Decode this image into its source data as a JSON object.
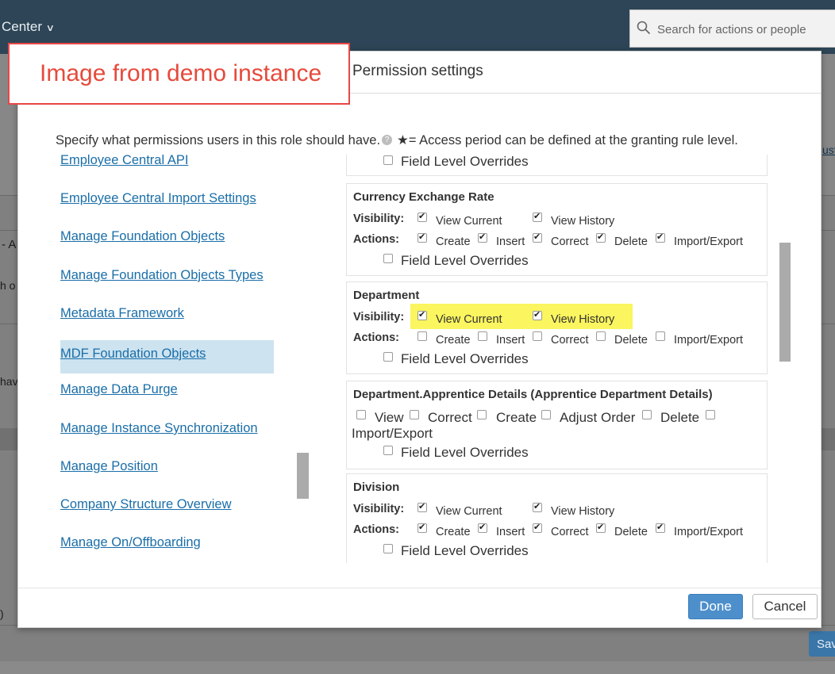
{
  "app": {
    "title": "Center",
    "search_placeholder": "Search for actions or people",
    "bg_texts": {
      "dash_a": "- A",
      "h_o": "h o",
      "hav": "hav",
      "paren": ")",
      "link_ust": "ust",
      "save_partial": "Sav"
    }
  },
  "annotation": {
    "label": "Image from demo instance"
  },
  "dialog": {
    "title": "Permission settings",
    "instructions": "Specify what permissions users in this role should have.",
    "star_note": "★= Access period can be defined at the granting rule level.",
    "categories": [
      "Employee Central API",
      "Employee Central Import Settings",
      "Manage Foundation Objects",
      "Manage Foundation Objects Types",
      "Metadata Framework",
      "MDF Foundation Objects",
      "Manage Data Purge",
      "Manage Instance Synchronization",
      "Manage Position",
      "Company Structure Overview",
      "Manage On/Offboarding"
    ],
    "selected_category": "MDF Foundation Objects",
    "labels": {
      "visibility": "Visibility:",
      "actions": "Actions:",
      "view_current": "View Current",
      "view_history": "View History",
      "create": "Create",
      "insert": "Insert",
      "correct": "Correct",
      "delete": "Delete",
      "import_export": "Import/Export",
      "field_level_overrides": "Field Level Overrides",
      "view": "View",
      "adjust_order": "Adjust Order"
    },
    "sections": [
      {
        "title": "Currency Exchange Rate",
        "view_current": true,
        "view_history": true,
        "create": true,
        "insert": true,
        "correct": true,
        "delete": true,
        "import_export": true,
        "field_level_overrides": false
      },
      {
        "title": "Department",
        "view_current": true,
        "view_history": true,
        "create": false,
        "insert": false,
        "correct": false,
        "delete": false,
        "import_export": false,
        "field_level_overrides": false
      },
      {
        "title": "Department.Apprentice Details (Apprentice Department Details)",
        "view": false,
        "correct": false,
        "create": false,
        "adjust_order": false,
        "delete": false,
        "import_export": false,
        "field_level_overrides": false
      },
      {
        "title": "Division",
        "view_current": true,
        "view_history": true,
        "create": true,
        "insert": true,
        "correct": true,
        "delete": true,
        "import_export": true,
        "field_level_overrides": false
      }
    ],
    "buttons": {
      "done": "Done",
      "cancel": "Cancel"
    }
  }
}
